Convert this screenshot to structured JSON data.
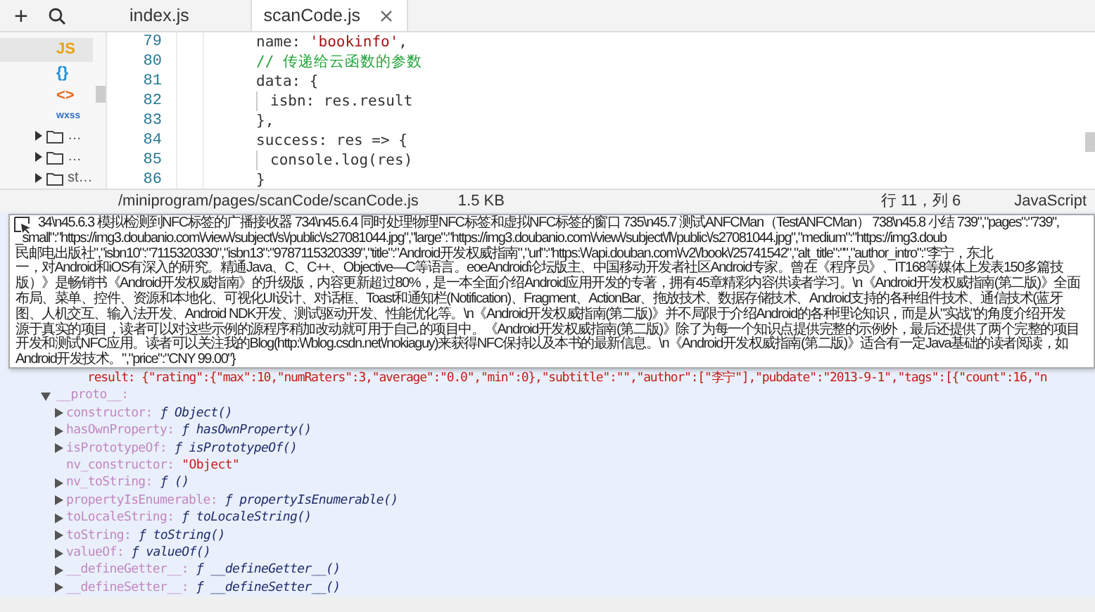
{
  "sidebar": {
    "add_glyph": "+",
    "file_icons": [
      {
        "kind": "js",
        "label": "JS",
        "selected": true
      },
      {
        "kind": "json",
        "label": "{}",
        "selected": false
      },
      {
        "kind": "html",
        "label": "<>",
        "selected": false
      },
      {
        "kind": "wxss",
        "label": "wxss",
        "selected": false
      }
    ],
    "folders": [
      {
        "name": "…"
      },
      {
        "name": "…"
      },
      {
        "name": "st…"
      }
    ]
  },
  "tabs": [
    {
      "label": "index.js",
      "selected": false,
      "closable": false
    },
    {
      "label": "scanCode.js",
      "selected": true,
      "closable": true
    }
  ],
  "editor": {
    "lines": [
      {
        "number": "79",
        "guide": false,
        "tokens": [
          {
            "kind": "plain",
            "text": "name: "
          },
          {
            "kind": "string",
            "text": "'bookinfo'"
          },
          {
            "kind": "plain",
            "text": ","
          }
        ]
      },
      {
        "number": "80",
        "guide": false,
        "tokens": [
          {
            "kind": "comment",
            "text": "// 传递给云函数的参数"
          }
        ]
      },
      {
        "number": "81",
        "guide": false,
        "tokens": [
          {
            "kind": "plain",
            "text": "data: {"
          }
        ]
      },
      {
        "number": "82",
        "guide": true,
        "tokens": [
          {
            "kind": "plain",
            "text": "isbn: res.result"
          }
        ]
      },
      {
        "number": "83",
        "guide": false,
        "tokens": [
          {
            "kind": "plain",
            "text": "},"
          }
        ]
      },
      {
        "number": "84",
        "guide": false,
        "tokens": [
          {
            "kind": "plain",
            "text": "success: res => {"
          }
        ]
      },
      {
        "number": "85",
        "guide": true,
        "tokens": [
          {
            "kind": "plain",
            "text": "console.log(res)"
          }
        ]
      },
      {
        "number": "86",
        "guide": false,
        "tokens": [
          {
            "kind": "plain",
            "text": "}"
          }
        ]
      }
    ]
  },
  "status_bar": {
    "path": "/miniprogram/pages/scanCode/scanCode.js",
    "size": "1.5 KB",
    "position": "行 11，列 6",
    "language": "JavaScript"
  },
  "tooltip": {
    "lines": [
      "34\\n45.6.3 模拟检测到NFC标签的广播接收器 734\\n45.6.4 同时处理物理NFC标签和虚拟NFC标签的窗口 735\\n45.7 测试ANFCMan（TestANFCMan） 738\\n45.8 小结 739\",\"pages\":\"739\",",
      "_small\":\"https://img3.doubanio.com\\/view\\/subject\\/s\\/public\\/s27081044.jpg\",\"large\":\"https://img3.doubanio.com\\/view\\/subject\\/l\\/public\\/s27081044.jpg\",\"medium\":\"https://img3.doub",
      "民邮电出版社\",\"isbn10\":\"7115320330\",\"isbn13\":\"9787115320339\",\"title\":\"Android开发权威指南\",\"url\":\"https:\\/\\/api.douban.com\\/v2\\/book\\/25741542\",\"alt_title\":\"\",\"author_intro\":\"李宁，东北",
      "一，对Android和iOS有深入的研究。精通Java、C、C++、Objective—C等语言。eoeAndroid论坛版主、中国移动开发者社区Android专家。曾在《程序员》、IT168等媒体上发表150多篇技",
      "版）》是畅销书《Android开发权威指南》的升级版，内容更新超过80%，是一本全面介绍Android应用开发的专著，拥有45章精彩内容供读者学习。\\n《Android开发权威指南(第二版)》全面",
      "布局、菜单、控件、资源和本地化、可视化UI设计、对话框、Toast和通知栏(Notification)、Fragment、ActionBar、拖放技术、数据存储技术、Android支持的各种组件技术、通信技术(蓝牙",
      "图、人机交互、输入法开发、Android NDK开发、测试驱动开发、性能优化等。\\n《Android开发权威指南(第二版)》并不局限于介绍Android的各种理论知识，而是从\"实战\"的角度介绍开发",
      "源于真实的项目，读者可以对这些示例的源程序稍加改动就可用于自己的项目中。《Android开发权威指南(第二版)》除了为每一个知识点提供完整的示例外，最后还提供了两个完整的项目",
      "开发和测试NFC应用。读者可以关注我的Blog(http:\\/\\/blog.csdn.net\\/nokiaguy)来获得NFC保持以及本书的最新信息。\\n《Android开发权威指南(第二版)》适合有一定Java基础的读者阅读，如",
      "Android开发技术。\",\"price\":\"CNY 99.00\"}"
    ]
  },
  "console": {
    "result_line": "result: {\"rating\":{\"max\":10,\"numRaters\":3,\"average\":\"0.0\",\"min\":0},\"subtitle\":\"\",\"author\":[\"李宁\"],\"pubdate\":\"2013-9-1\",\"tags\":[{\"count\":16,\"n",
    "proto": {
      "key": "__proto__:",
      "expanded": true,
      "children": [
        {
          "key": "constructor:",
          "kind": "function",
          "value": "ƒ Object()",
          "expandable": true
        },
        {
          "key": "hasOwnProperty:",
          "kind": "function",
          "value": "ƒ hasOwnProperty()",
          "expandable": true
        },
        {
          "key": "isPrototypeOf:",
          "kind": "function",
          "value": "ƒ isPrototypeOf()",
          "expandable": true
        },
        {
          "key": "nv_constructor:",
          "kind": "string",
          "value": "\"Object\"",
          "expandable": false
        },
        {
          "key": "nv_toString:",
          "kind": "function",
          "value": "ƒ ()",
          "expandable": true
        },
        {
          "key": "propertyIsEnumerable:",
          "kind": "function",
          "value": "ƒ propertyIsEnumerable()",
          "expandable": true
        },
        {
          "key": "toLocaleString:",
          "kind": "function",
          "value": "ƒ toLocaleString()",
          "expandable": true
        },
        {
          "key": "toString:",
          "kind": "function",
          "value": "ƒ toString()",
          "expandable": true
        },
        {
          "key": "valueOf:",
          "kind": "function",
          "value": "ƒ valueOf()",
          "expandable": true
        },
        {
          "key": "__defineGetter__:",
          "kind": "function",
          "value": "ƒ __defineGetter__()",
          "expandable": true
        },
        {
          "key": "__defineSetter__:",
          "kind": "function",
          "value": "ƒ __defineSetter__()",
          "expandable": true
        }
      ]
    }
  }
}
